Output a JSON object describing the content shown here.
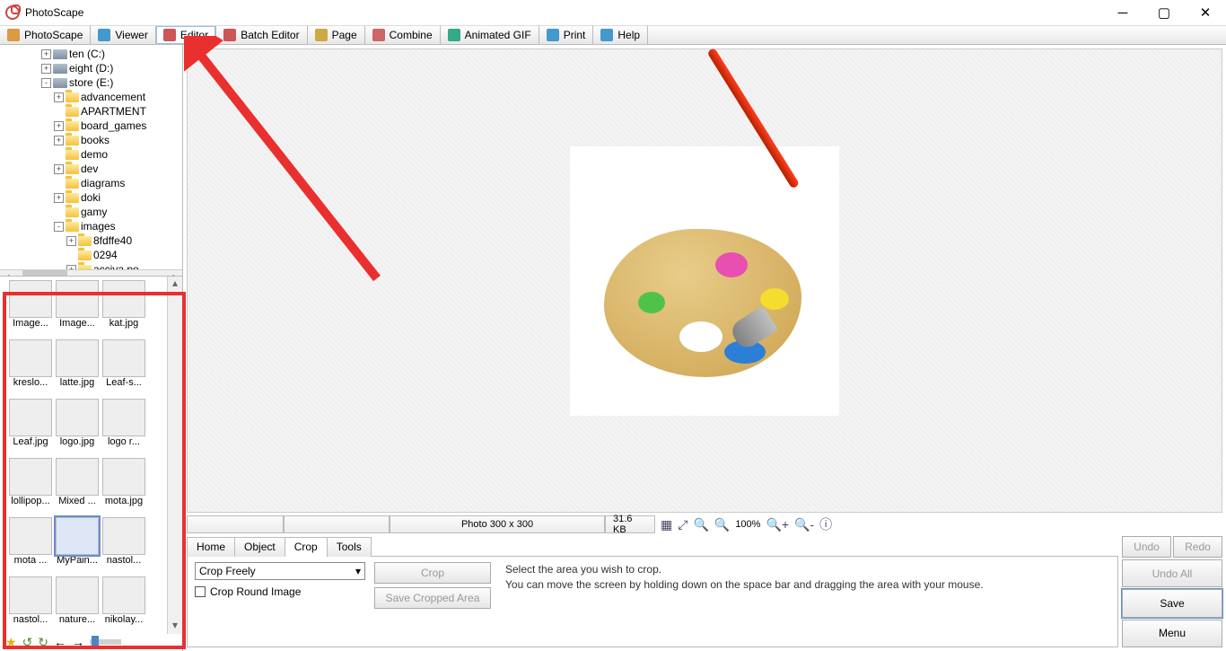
{
  "app_title": "PhotoScape",
  "tabs": [
    "PhotoScape",
    "Viewer",
    "Editor",
    "Batch Editor",
    "Page",
    "Combine",
    "Animated GIF",
    "Print",
    "Help"
  ],
  "active_tab": 2,
  "tree": [
    {
      "depth": 3,
      "exp": "+",
      "icon": "drv",
      "label": "ten (C:)"
    },
    {
      "depth": 3,
      "exp": "+",
      "icon": "drv",
      "label": "eight (D:)"
    },
    {
      "depth": 3,
      "exp": "-",
      "icon": "drv",
      "label": "store (E:)"
    },
    {
      "depth": 4,
      "exp": "+",
      "icon": "fld",
      "label": "advancement"
    },
    {
      "depth": 4,
      "exp": " ",
      "icon": "fld",
      "label": "APARTMENT"
    },
    {
      "depth": 4,
      "exp": "+",
      "icon": "fld",
      "label": "board_games"
    },
    {
      "depth": 4,
      "exp": "+",
      "icon": "fld",
      "label": "books"
    },
    {
      "depth": 4,
      "exp": " ",
      "icon": "fld",
      "label": "demo"
    },
    {
      "depth": 4,
      "exp": "+",
      "icon": "fld",
      "label": "dev"
    },
    {
      "depth": 4,
      "exp": " ",
      "icon": "fld",
      "label": "diagrams"
    },
    {
      "depth": 4,
      "exp": "+",
      "icon": "fld",
      "label": "doki"
    },
    {
      "depth": 4,
      "exp": " ",
      "icon": "fld",
      "label": "gamy"
    },
    {
      "depth": 4,
      "exp": "-",
      "icon": "fld",
      "label": "images"
    },
    {
      "depth": 5,
      "exp": "+",
      "icon": "fld",
      "label": "8fdffe40"
    },
    {
      "depth": 5,
      "exp": " ",
      "icon": "fld",
      "label": "0294"
    },
    {
      "depth": 5,
      "exp": "+",
      "icon": "fld",
      "label": "acciya po"
    }
  ],
  "thumbs": [
    {
      "label": "Image...",
      "c": "c-dark"
    },
    {
      "label": "Image...",
      "c": "c-dark"
    },
    {
      "label": "kat.jpg",
      "c": "c-brown"
    },
    {
      "label": "kreslo...",
      "c": "c-brown"
    },
    {
      "label": "latte.jpg",
      "c": "c-latte"
    },
    {
      "label": "Leaf-s...",
      "c": "c-leaf"
    },
    {
      "label": "Leaf.jpg",
      "c": "c-leaf"
    },
    {
      "label": "logo.jpg",
      "c": "c-logo"
    },
    {
      "label": "logo r...",
      "c": "c-black"
    },
    {
      "label": "lollipop...",
      "c": "c-phone"
    },
    {
      "label": "Mixed ...",
      "c": "c-flowers"
    },
    {
      "label": "mota.jpg",
      "c": "c-guy"
    },
    {
      "label": "mota ...",
      "c": "c-guy"
    },
    {
      "label": "MyPain...",
      "c": "c-paint",
      "sel": true
    },
    {
      "label": "nastol...",
      "c": "c-sunset"
    },
    {
      "label": "nastol...",
      "c": "c-green"
    },
    {
      "label": "nature...",
      "c": "c-sky"
    },
    {
      "label": "nikolay...",
      "c": "c-draw"
    }
  ],
  "status": {
    "dim": "Photo 300 x 300",
    "size": "31.6 KB",
    "zoom": "100%"
  },
  "tool_tabs": [
    "Home",
    "Object",
    "Crop",
    "Tools"
  ],
  "tool_active": 2,
  "crop": {
    "mode": "Crop Freely",
    "round": "Crop Round Image",
    "btn_crop": "Crop",
    "btn_save": "Save Cropped Area",
    "help1": "Select the area you wish to crop.",
    "help2": "You can move the screen by holding down on the space bar and dragging the area with your mouse."
  },
  "right_buttons": {
    "undo": "Undo",
    "redo": "Redo",
    "undo_all": "Undo All",
    "save": "Save",
    "menu": "Menu"
  }
}
